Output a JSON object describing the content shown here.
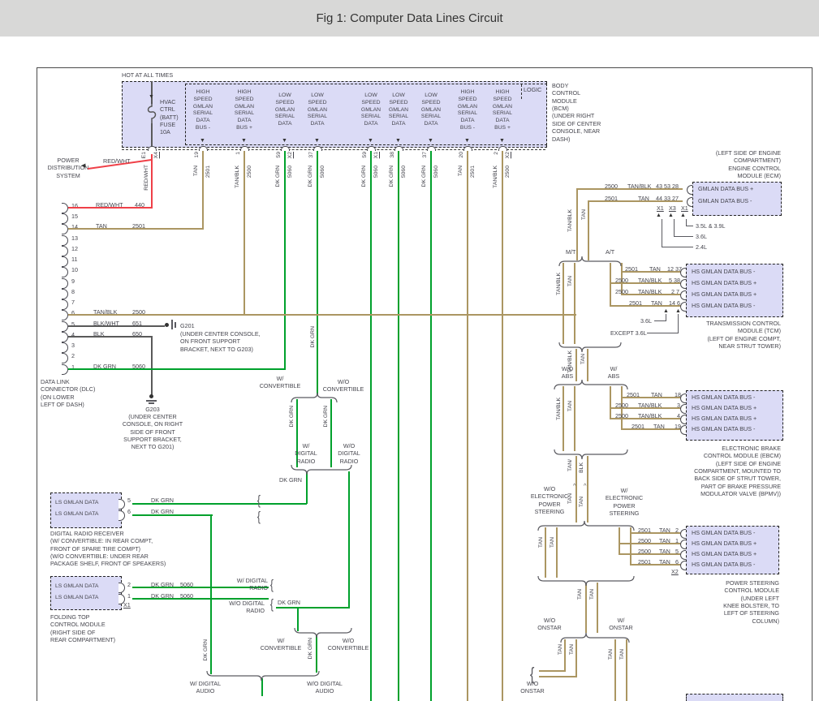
{
  "title": "Fig 1: Computer Data Lines Circuit",
  "header": {
    "hot": "HOT AT ALL TIMES",
    "logic": "LOGIC",
    "fuse": "HVAC\nCTRL\n(BATT)\nFUSE\n10A",
    "e1": "E1",
    "x4": "X4",
    "module": "BODY\nCONTROL\nMODULE\n(BCM)\n(UNDER RIGHT\nSIDE OF CENTER\nCONSOLE, NEAR\nDASH)"
  },
  "bcm_columns": [
    {
      "pin": "19",
      "wire": "TAN",
      "ckt": "2501",
      "label": "HIGH\nSPEED\nGMLAN\nSERIAL\nDATA\nBUS -"
    },
    {
      "pin": "1",
      "wire": "TAN/BLK",
      "ckt": "2500",
      "label": "HIGH\nSPEED\nGMLAN\nSERIAL\nDATA\nBUS +"
    },
    {
      "pin": "59",
      "conn": "X2",
      "wire": "DK GRN",
      "ckt": "5060",
      "label": "LOW\nSPEED\nGMLAN\nSERIAL\nDATA"
    },
    {
      "pin": "37",
      "wire": "DK GRN",
      "ckt": "5060",
      "label": "LOW\nSPEED\nGMLAN\nSERIAL\nDATA"
    },
    {
      "pin": "59",
      "conn": "X1",
      "wire": "DK GRN",
      "ckt": "5060",
      "label": "LOW\nSPEED\nGMLAN\nSERIAL\nDATA"
    },
    {
      "pin": "38",
      "wire": "DK GRN",
      "ckt": "5060",
      "label": "LOW\nSPEED\nGMLAN\nSERIAL\nDATA"
    },
    {
      "pin": "37",
      "wire": "DK GRN",
      "ckt": "5060",
      "label": "LOW\nSPEED\nGMLAN\nSERIAL\nDATA"
    },
    {
      "pin": "20",
      "wire": "TAN",
      "ckt": "2501",
      "label": "HIGH\nSPEED\nGMLAN\nSERIAL\nDATA\nBUS -"
    },
    {
      "pin": "2",
      "conn": "X2",
      "wire": "TAN/BLK",
      "ckt": "2500",
      "label": "HIGH\nSPEED\nGMLAN\nSERIAL\nDATA\nBUS +"
    }
  ],
  "power": {
    "label": "POWER\nDISTRIBUTION\nSYSTEM",
    "wire": "RED/WHT"
  },
  "dlc": {
    "pins": [
      "16",
      "15",
      "14",
      "13",
      "12",
      "11",
      "10",
      "9",
      "8",
      "7",
      "6",
      "5",
      "4",
      "3",
      "2",
      "1"
    ],
    "r16": {
      "w": "RED/WHT",
      "c": "440"
    },
    "r14": {
      "w": "TAN",
      "c": "2501"
    },
    "r6": {
      "w": "TAN/BLK",
      "c": "2500"
    },
    "r5": {
      "w": "BLK/WHT",
      "c": "651"
    },
    "r4": {
      "w": "BLK",
      "c": "650"
    },
    "r1": {
      "w": "DK GRN",
      "c": "5060"
    },
    "name": "DATA LINK\nCONNECTOR (DLC)\n(ON LOWER\nLEFT OF DASH)"
  },
  "grounds": {
    "g201": "G201",
    "g201_loc": "(UNDER CENTER CONSOLE,\nON FRONT SUPPORT\nBRACKET, NEXT TO G203)",
    "g203": "G203",
    "g203_loc": "(UNDER CENTER\nCONSOLE, ON RIGHT\nSIDE OF FRONT\nSUPPORT BRACKET,\nNEXT TO G201)"
  },
  "ecm": {
    "title": "(LEFT SIDE OF ENGINE\nCOMPARTMENT)\nENGINE CONTROL\nMODULE (ECM)",
    "rows": [
      {
        "c": "2500",
        "w": "TAN/BLK",
        "p": "43 53 28",
        "bus": "GMLAN DATA BUS +"
      },
      {
        "c": "2501",
        "w": "TAN",
        "p": "44 33 27",
        "bus": "GMLAN DATA BUS -"
      }
    ],
    "conns": [
      "X1",
      "X3",
      "X1"
    ],
    "engines": [
      "3.5L & 3.9L",
      "3.6L",
      "2.4L"
    ]
  },
  "tcm": {
    "mt": "M/T",
    "at": "A/T",
    "rows": [
      {
        "c": "2501",
        "w": "TAN",
        "p": "12 37",
        "bus": "HS GMLAN DATA BUS -"
      },
      {
        "c": "2500",
        "w": "TAN/BLK",
        "p": "5 38",
        "bus": "HS GMLAN DATA BUS +"
      },
      {
        "c": "2500",
        "w": "TAN/BLK",
        "p": "2 7",
        "bus": "HS GMLAN DATA BUS +"
      },
      {
        "c": "2501",
        "w": "TAN",
        "p": "14 6",
        "bus": "HS GMLAN DATA BUS -"
      }
    ],
    "eng1": "3.6L",
    "eng2": "EXCEPT 3.6L",
    "title": "TRANSMISSION CONTROL\nMODULE (TCM)\n(LEFT OF ENGINE COMPT,\nNEAR STRUT TOWER)"
  },
  "ebcm": {
    "wo": "W/O\nABS",
    "w": "W/\nABS",
    "rows": [
      {
        "c": "2501",
        "w": "TAN",
        "p": "18",
        "bus": "HS GMLAN DATA BUS -"
      },
      {
        "c": "2500",
        "w": "TAN/BLK",
        "p": "3",
        "bus": "HS GMLAN DATA BUS +"
      },
      {
        "c": "2500",
        "w": "TAN/BLK",
        "p": "4",
        "bus": "HS GMLAN DATA BUS +"
      },
      {
        "c": "2501",
        "w": "TAN",
        "p": "19",
        "bus": "HS GMLAN DATA BUS -"
      }
    ],
    "title": "ELECTRONIC BRAKE\nCONTROL MODULE (EBCM)\n(LEFT SIDE OF ENGINE\nCOMPARTMENT, MOUNTED TO\nBACK SIDE OF STRUT TOWER,\nPART OF BRAKE PRESSURE\nMODULATOR VALVE (BPMV))"
  },
  "pscm": {
    "wo": "W/O\nELECTRONIC\nPOWER\nSTEERING",
    "w": "W/\nELECTRONIC\nPOWER\nSTEERING",
    "rows": [
      {
        "c": "2501",
        "w": "TAN",
        "p": "2",
        "bus": "HS GMLAN DATA BUS -"
      },
      {
        "c": "2500",
        "w": "TAN",
        "p": "1",
        "bus": "HS GMLAN DATA BUS +"
      },
      {
        "c": "2500",
        "w": "TAN",
        "p": "5",
        "bus": "HS GMLAN DATA BUS +"
      },
      {
        "c": "2501",
        "w": "TAN",
        "p": "6",
        "bus": "HS GMLAN DATA BUS -"
      }
    ],
    "conn": "X2",
    "title": "POWER STEERING\nCONTROL MODULE\n(UNDER LEFT\nKNEE BOLSTER, TO\nLEFT OF STEERING\nCOLUMN)"
  },
  "onstar": {
    "wo": "W/O\nONSTAR",
    "w": "W/\nONSTAR",
    "wo2": "W/O\nONSTAR"
  },
  "options": {
    "w_conv": "W/\nCONVERTIBLE",
    "wo_conv": "W/O\nCONVERTIBLE",
    "w_radio": "W/\nDIGITAL\nRADIO",
    "wo_radio": "W/O\nDIGITAL\nRADIO",
    "w_radio2": "W/ DIGITAL\nRADIO",
    "wo_radio2": "W/O DIGITAL\nRADIO",
    "w_conv2": "W/\nCONVERTIBLE",
    "wo_conv2": "W/O\nCONVERTIBLE",
    "w_audio": "W/ DIGITAL\nAUDIO",
    "wo_audio": "W/O DIGITAL\nAUDIO"
  },
  "receiver": {
    "row1": "LS GMLAN DATA",
    "row2": "LS GMLAN DATA",
    "pin1": "5",
    "pin2": "6",
    "name": "DIGITAL RADIO RECEIVER\n(W/ CONVERTIBLE: IN REAR COMPT,\nFRONT OF SPARE TIRE COMPT)\n(W/O CONVERTIBLE: UNDER REAR\nPACKAGE SHELF, FRONT OF SPEAKERS)"
  },
  "folding": {
    "row1": "LS GMLAN DATA",
    "row2": "LS GMLAN DATA",
    "pin1": "2",
    "pin2": "1",
    "conn": "X1",
    "name": "FOLDING TOP\nCONTROL MODULE\n(RIGHT SIDE OF\nREAR COMPARTMENT)"
  },
  "wire_labels": {
    "tan": "TAN",
    "tanblk": "TAN/BLK",
    "tansp1": "TAN/",
    "tansp2": "BLK",
    "dkgrn": "DK GRN",
    "redwht": "RED/WHT",
    "c2500": "2500",
    "c2501": "2501",
    "c5060": "5060"
  },
  "colors": {
    "tan": "#ab9662",
    "green": "#00a12c",
    "red": "#ef4048",
    "black": "#5a5a5a",
    "module_fill": "#dbdbf6",
    "titlebar": "#d8d8d7"
  }
}
